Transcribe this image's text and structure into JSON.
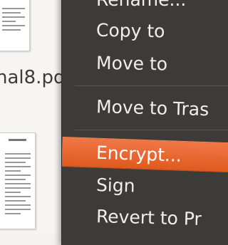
{
  "file_manager": {
    "file_name": "nal8.pd"
  },
  "context_menu": {
    "items": [
      {
        "label": "Rename..."
      },
      {
        "label": "Copy to"
      },
      {
        "label": "Move to"
      },
      {
        "label": "Move to Tras"
      },
      {
        "label": "Encrypt..."
      },
      {
        "label": "Sign"
      },
      {
        "label": "Revert to Pr"
      }
    ],
    "highlight_color": "#e8622b",
    "background_color": "#3c3b37"
  }
}
